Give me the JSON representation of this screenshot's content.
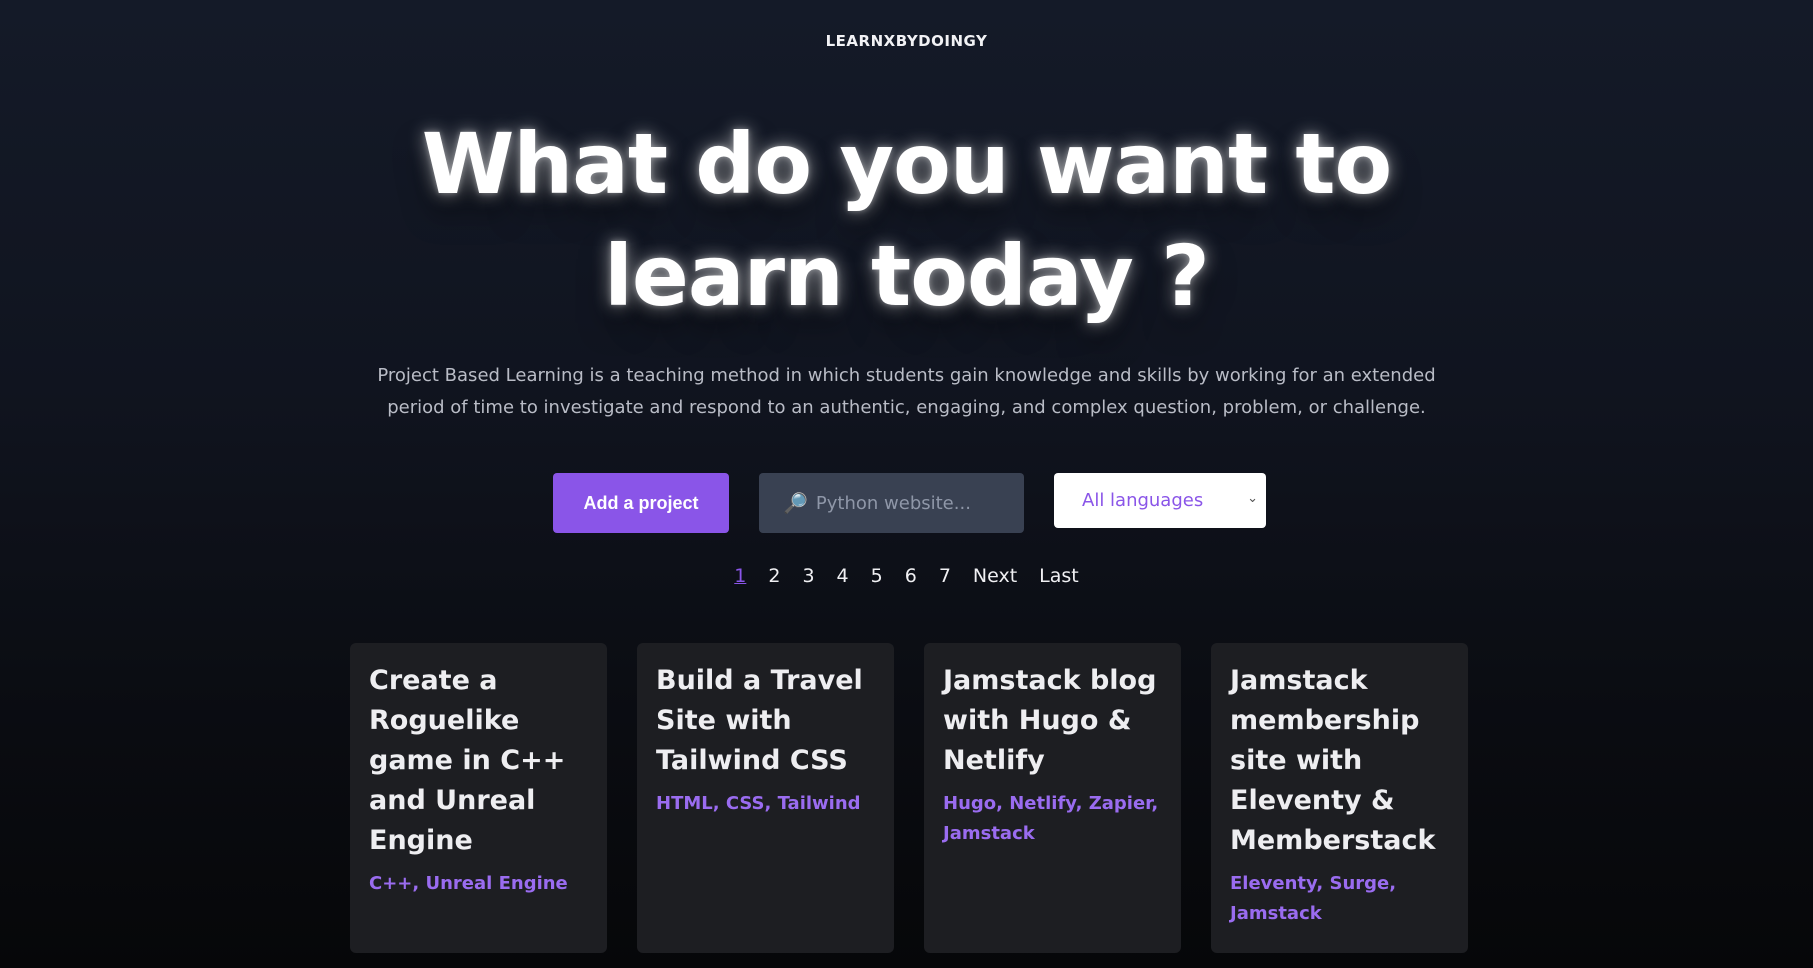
{
  "brand": "LEARNXBYDOINGY",
  "hero": {
    "line1": "What do you want to",
    "line2": "learn today ?"
  },
  "description": "Project Based Learning is a teaching method in which students gain knowledge and skills by working for an extended period of time to investigate and respond to an authentic, engaging, and complex question, problem, or challenge.",
  "controls": {
    "add_label": "Add a project",
    "search_placeholder": "Python website...",
    "search_icon": "magnifier-icon",
    "language_selected": "All languages"
  },
  "pagination": {
    "pages": [
      "1",
      "2",
      "3",
      "4",
      "5",
      "6",
      "7"
    ],
    "next": "Next",
    "last": "Last",
    "active": "1"
  },
  "cards": [
    {
      "title": "Create a Roguelike game in C++ and Unreal Engine",
      "tags": "C++, Unreal Engine"
    },
    {
      "title": "Build a Travel Site with Tailwind CSS",
      "tags": "HTML, CSS, Tailwind"
    },
    {
      "title": "Jamstack blog with Hugo & Netlify",
      "tags": "Hugo, Netlify, Zapier, Jamstack"
    },
    {
      "title": "Jamstack membership site with Eleventy & Memberstack",
      "tags": "Eleventy, Surge, Jamstack"
    }
  ],
  "colors": {
    "accent": "#8a55e8",
    "background": "#10141f",
    "card": "#1d1e22"
  }
}
